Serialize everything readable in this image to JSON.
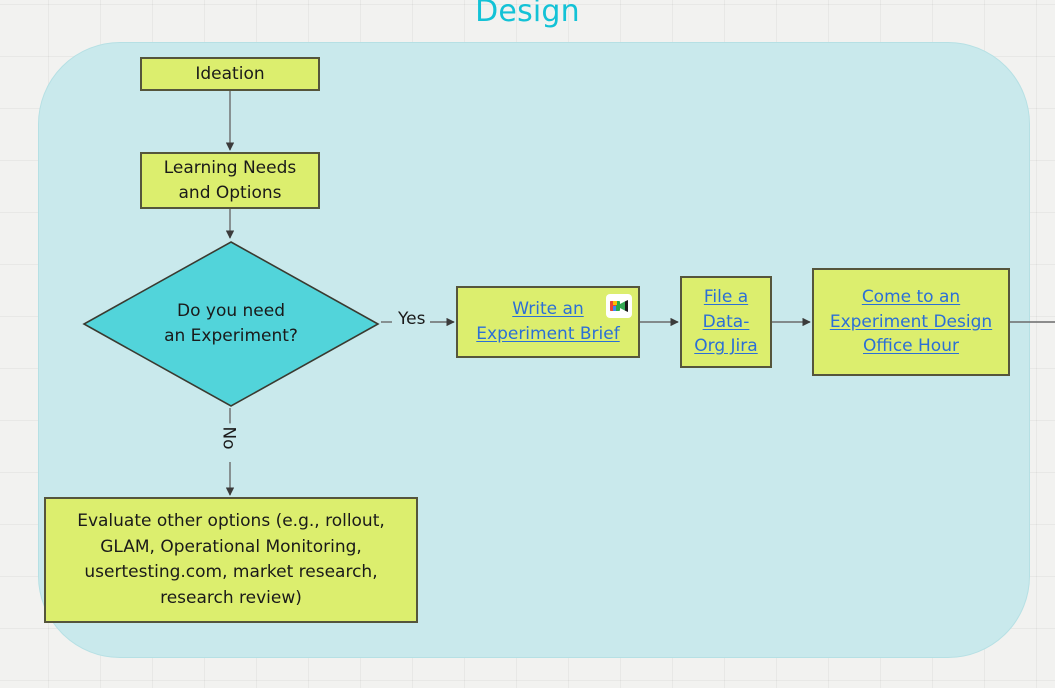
{
  "page": {
    "title": "Design",
    "title_color": "#13c2d6",
    "canvas_bg": "#f2f2f0",
    "container_fill": "#c9e9ec",
    "node_fill": "#dcee6e",
    "node_border": "#55553c",
    "decision_fill": "#52d4da",
    "link_color": "#2b6fd6"
  },
  "nodes": {
    "ideation": {
      "label": "Ideation"
    },
    "learning": {
      "line1": "Learning Needs",
      "line2": "and Options"
    },
    "decision": {
      "line1": "Do you need",
      "line2": "an Experiment?"
    },
    "brief": {
      "line1": "Write an ",
      "line2": "Experiment Brief",
      "is_link": "true",
      "icon": "video-icon"
    },
    "jira": {
      "line1": "File a ",
      "line2": "Data-",
      "line3": "Org Jira",
      "is_link": "true"
    },
    "office": {
      "line1": "Come to an ",
      "line2": "Experiment Design ",
      "line3": "Office Hour",
      "is_link": "true"
    },
    "evaluate": {
      "line1": "Evaluate other options (e.g., rollout,",
      "line2": "GLAM, Operational Monitoring,",
      "line3": "usertesting.com, market research,",
      "line4": "research review)"
    }
  },
  "edges": {
    "yes_label": "Yes",
    "no_label": "No"
  }
}
